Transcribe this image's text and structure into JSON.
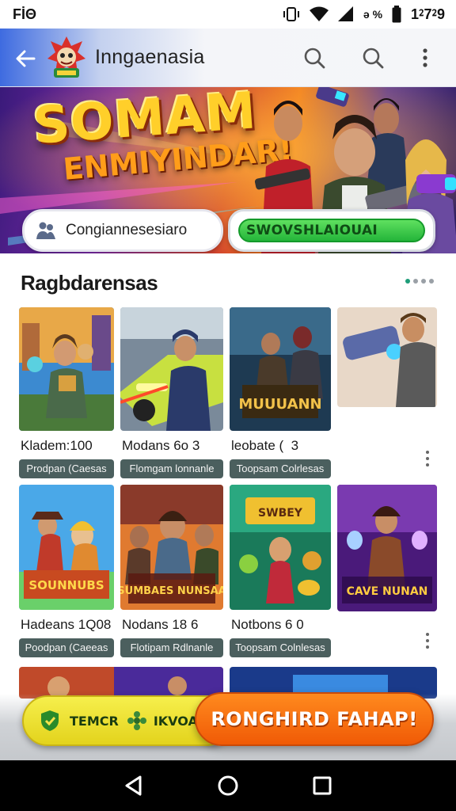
{
  "status_bar": {
    "left_text": "FİΘ",
    "battery_percent": "ə %",
    "time": "1⁲7⁲9"
  },
  "app_bar": {
    "title": "Inngaenasia"
  },
  "banner": {
    "headline": "SOMAM",
    "subheadline": "ENMIYINDAR!",
    "pill_left_text": "Congiannesesiaro",
    "pill_right_text": "SWOVSHLAIOUAI"
  },
  "section": {
    "title": "Ragbdarensas"
  },
  "cards": [
    {
      "title": "Kladem:1­0­0",
      "tag": "Prodpan (Caesas"
    },
    {
      "title": "Modans 6o 3",
      "tag": "Flomgam lonnanle"
    },
    {
      "title": "leobate (  3",
      "tag": "Toopsam Colrlesas"
    },
    {
      "title": "Hadeans 1Q08",
      "tag": "Poodpan (Caeeas"
    },
    {
      "title": "Nodans 18 6",
      "tag": "Flotipam Rdlnanle"
    },
    {
      "title": "Notbons 6 0",
      "tag": "Toopsam Colnlesas"
    }
  ],
  "card_art_text": [
    "MUUUANN",
    "SOUNNUBS",
    "SUMBAES NUNSAA",
    "SWBEY",
    "CAVE NUNAN"
  ],
  "cta": {
    "left_text_1": "TEMCR",
    "left_text_2": "IKVOA",
    "right_label": "RONGHIRD FAHAP!"
  },
  "colors": {
    "accent_green": "#1e9d79",
    "tag_bg": "#4b5f5e",
    "cta_orange": "#f05a06",
    "cta_yellow": "#e3d31c"
  },
  "icons": [
    "back-arrow-icon",
    "search-icon",
    "search-icon",
    "more-vert-icon",
    "nav-back-icon",
    "nav-home-icon",
    "nav-recents-icon"
  ]
}
